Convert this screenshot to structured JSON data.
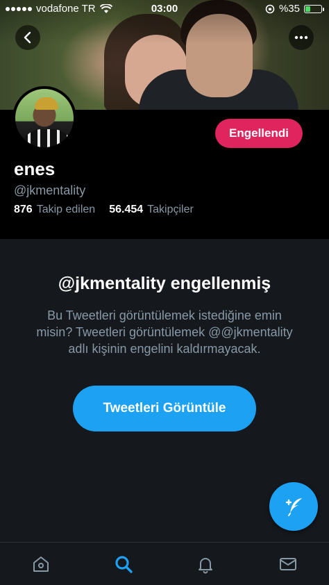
{
  "status_bar": {
    "carrier": "vodafone TR",
    "time": "03:00",
    "battery_percent": "%35",
    "battery_level": 0.35
  },
  "profile": {
    "name": "enes",
    "handle": "@jkmentality",
    "following_count": "876",
    "following_label": "Takip edilen",
    "followers_count": "56.454",
    "followers_label": "Takipçiler",
    "blocked_button_label": "Engellendi"
  },
  "blocked_notice": {
    "title": "@jkmentality engellenmiş",
    "body": "Bu Tweetleri görüntülemek istediğine emin misin? Tweetleri görüntülemek @@jkmentality adlı kişinin engelini kaldırmayacak.",
    "view_button_label": "Tweetleri Görüntüle"
  },
  "colors": {
    "accent": "#1da1f2",
    "blocked_red": "#e0245e",
    "background": "#15181c",
    "secondary_text": "#8899a6"
  },
  "bottom_nav": {
    "items": [
      "home-icon",
      "search-icon",
      "notifications-icon",
      "messages-icon"
    ],
    "active": "search-icon"
  }
}
